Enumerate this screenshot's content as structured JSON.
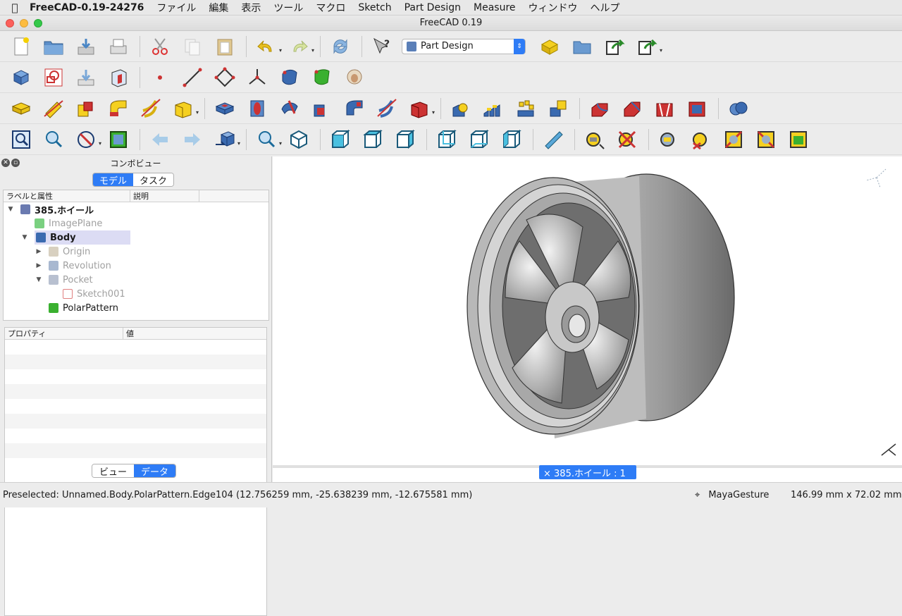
{
  "menubar": {
    "app_name": "FreeCAD-0.19-24276",
    "items": [
      "ファイル",
      "編集",
      "表示",
      "ツール",
      "マクロ",
      "Sketch",
      "Part Design",
      "Measure",
      "ウィンドウ",
      "ヘルプ"
    ]
  },
  "window": {
    "title": "FreeCAD 0.19"
  },
  "workbench": {
    "selected": "Part Design"
  },
  "combo": {
    "title": "コンボビュー",
    "tabs": [
      "モデル",
      "タスク"
    ],
    "tree_headers": [
      "ラベルと属性",
      "説明"
    ],
    "tree": [
      {
        "label": "385.ホイール",
        "level": 0,
        "expander": "▼",
        "style": "bold"
      },
      {
        "label": "ImagePlane",
        "level": 2,
        "expander": "",
        "style": "grey"
      },
      {
        "label": "Body",
        "level": 1,
        "expander": "▼",
        "style": "bold-selected"
      },
      {
        "label": "Origin",
        "level": 2,
        "expander": "▶",
        "style": "grey"
      },
      {
        "label": "Revolution",
        "level": 2,
        "expander": "▶",
        "style": "grey"
      },
      {
        "label": "Pocket",
        "level": 2,
        "expander": "▼",
        "style": "grey"
      },
      {
        "label": "Sketch001",
        "level": 3,
        "expander": "",
        "style": "grey"
      },
      {
        "label": "PolarPattern",
        "level": 2,
        "expander": "",
        "style": "normal"
      }
    ],
    "prop_headers": [
      "プロパティ",
      "値"
    ],
    "bottom_tabs": [
      "ビュー",
      "データ"
    ]
  },
  "document_tab": "× 385.ホイール : 1",
  "status": {
    "preselected": "Preselected: Unnamed.Body.PolarPattern.Edge104 (12.756259 mm, -25.638239 mm, -12.675581 mm)",
    "nav_style": "MayaGesture",
    "dimensions": "146.99 mm x 72.02 mm"
  },
  "colors": {
    "accent": "#2e7cf6",
    "selection": "#dcdcf4"
  }
}
